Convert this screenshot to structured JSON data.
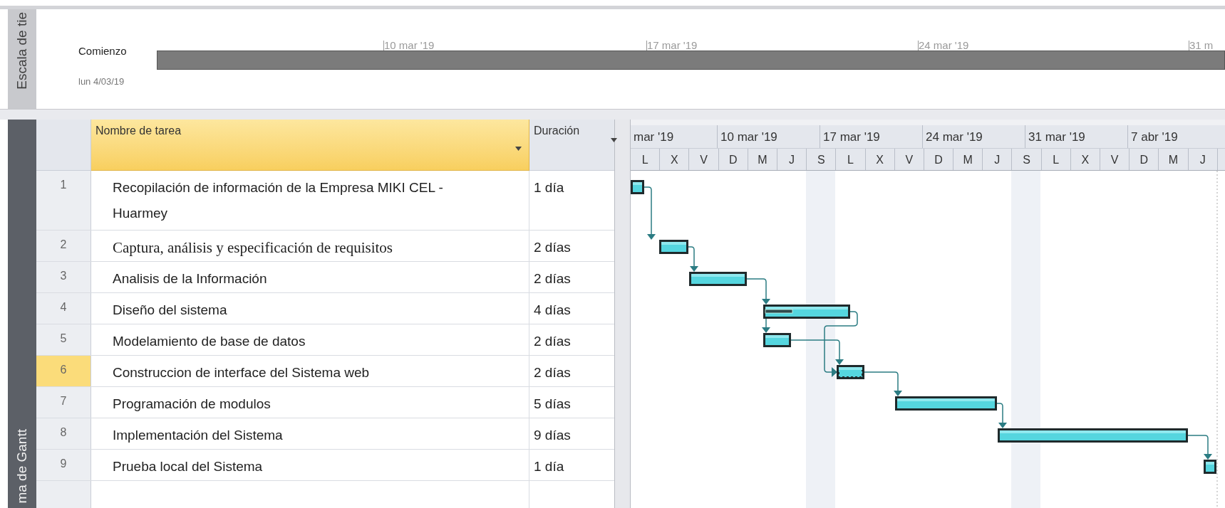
{
  "timescale": {
    "label": "Escala de tie",
    "start_label": "Comienzo",
    "start_date": "lun 4/03/19",
    "ticks": [
      "10 mar '19",
      "17 mar '19",
      "24 mar '19",
      "31 m"
    ]
  },
  "view_label": "ma de Gantt",
  "table": {
    "columns": [
      {
        "label": "Nombre de tarea",
        "selected": true
      },
      {
        "label": "Duración",
        "selected": false
      }
    ],
    "rows": [
      {
        "id": "1",
        "name": "Recopilación de información de la Empresa MIKI CEL - Huarmey",
        "duration": "1 día",
        "selected": false
      },
      {
        "id": "2",
        "name": "Captura, análisis y especificación de requisitos",
        "duration": "2 días",
        "selected": false
      },
      {
        "id": "3",
        "name": "Analisis de la Información",
        "duration": "2 días",
        "selected": false
      },
      {
        "id": "4",
        "name": "Diseño del sistema",
        "duration": "4 días",
        "selected": false
      },
      {
        "id": "5",
        "name": "Modelamiento de base de datos",
        "duration": "2 días",
        "selected": false
      },
      {
        "id": "6",
        "name": "Construccion de interface del Sistema web",
        "duration": "2 días",
        "selected": true
      },
      {
        "id": "7",
        "name": "Programación de modulos",
        "duration": "5 días",
        "selected": false
      },
      {
        "id": "8",
        "name": "Implementación del Sistema",
        "duration": "9 días",
        "selected": false
      },
      {
        "id": "9",
        "name": "Prueba local del Sistema",
        "duration": "1 día",
        "selected": false
      }
    ]
  },
  "gantt": {
    "weeks": [
      "mar '19",
      "10 mar '19",
      "17 mar '19",
      "24 mar '19",
      "31 mar '19",
      "7 abr '19"
    ],
    "days": [
      "L",
      "X",
      "V",
      "D",
      "M",
      "J",
      "S",
      "L",
      "X",
      "V",
      "D",
      "M",
      "J",
      "S",
      "L",
      "X",
      "V",
      "D",
      "M",
      "J"
    ]
  }
}
